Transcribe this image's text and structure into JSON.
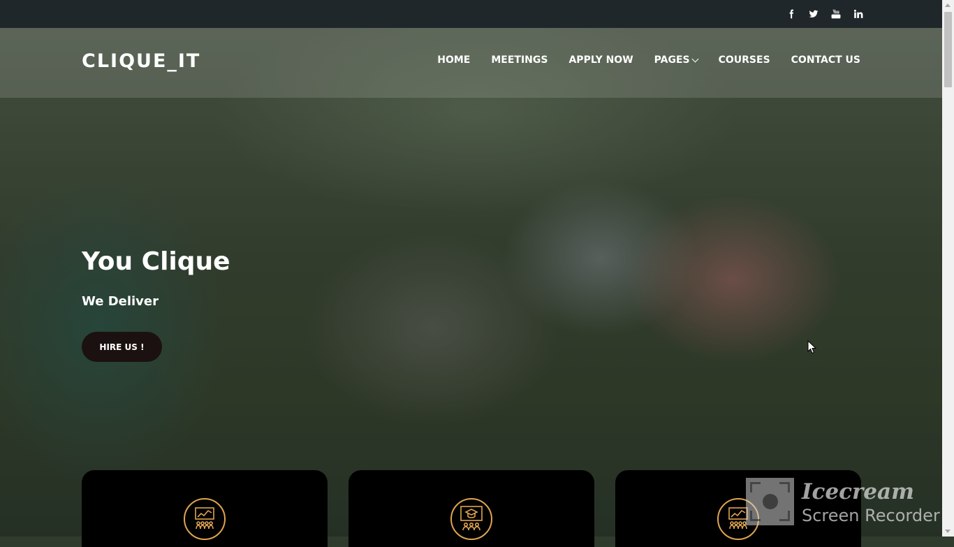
{
  "brand": {
    "logo": "CLIQUE_IT"
  },
  "social": [
    "facebook-icon",
    "twitter-icon",
    "youtube-icon",
    "linkedin-icon"
  ],
  "nav": {
    "home": "HOME",
    "meetings": "MEETINGS",
    "apply": "APPLY NOW",
    "pages": "PAGES",
    "courses": "COURSES",
    "contact": "CONTACT US"
  },
  "hero": {
    "title": "You Clique",
    "subtitle": "We Deliver",
    "cta": "HIRE US !"
  },
  "cards": [
    {
      "icon": "presentation-audience-icon"
    },
    {
      "icon": "graduation-board-icon"
    },
    {
      "icon": "presentation-audience-icon"
    }
  ],
  "watermark": {
    "line1": "Icecream",
    "line2": "Screen Recorder"
  },
  "colors": {
    "topbar": "#1f272b",
    "button": "#1b1110",
    "card": "#000000",
    "icon_accent": "#e0a450"
  }
}
